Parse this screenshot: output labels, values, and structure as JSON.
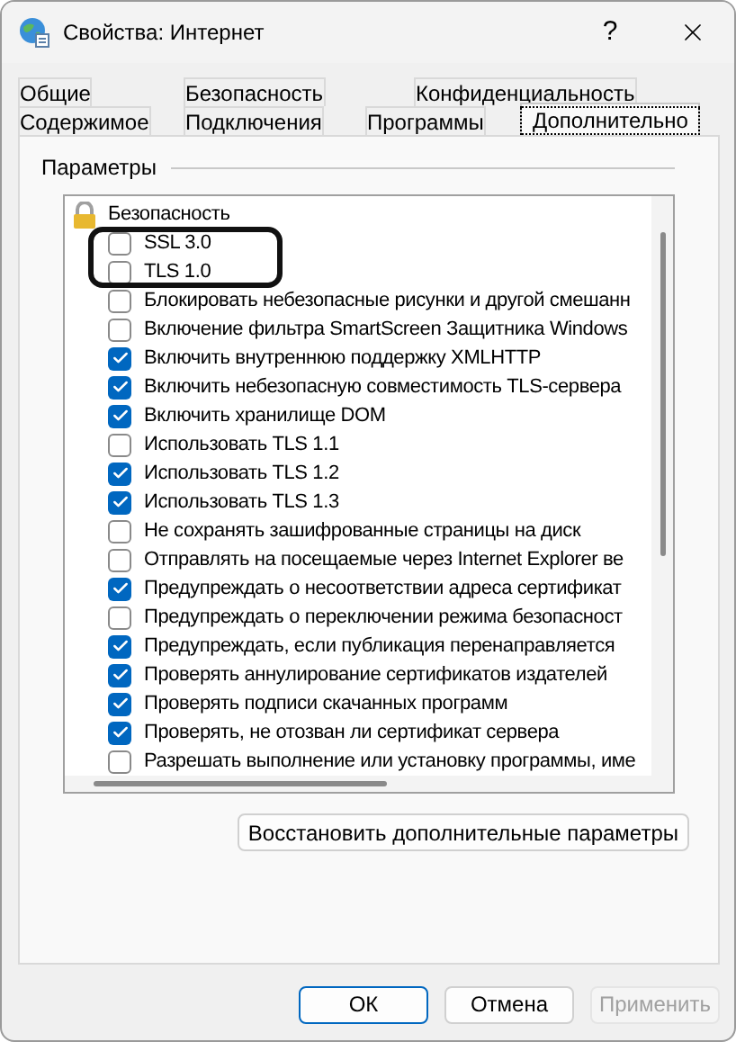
{
  "window": {
    "title": "Свойства: Интернет",
    "help": "?"
  },
  "tabs_back": [
    {
      "label": "Общие",
      "selected": false
    },
    {
      "label": "Безопасность",
      "selected": false
    },
    {
      "label": "Конфиденциальность",
      "selected": false
    }
  ],
  "tabs": [
    {
      "label": "Содержимое",
      "selected": false
    },
    {
      "label": "Подключения",
      "selected": false
    },
    {
      "label": "Программы",
      "selected": false
    },
    {
      "label": "Дополнительно",
      "selected": true
    }
  ],
  "group": {
    "title": "Параметры"
  },
  "settings": [
    {
      "kind": "header",
      "label": "Безопасность"
    },
    {
      "kind": "checkbox",
      "label": "SSL 3.0",
      "checked": false
    },
    {
      "kind": "checkbox",
      "label": "TLS 1.0",
      "checked": false
    },
    {
      "kind": "checkbox",
      "label": "Блокировать небезопасные рисунки и другой смешанн",
      "checked": false
    },
    {
      "kind": "checkbox",
      "label": "Включение фильтра SmartScreen Защитника Windows",
      "checked": false
    },
    {
      "kind": "checkbox",
      "label": "Включить внутреннюю поддержку XMLHTTP",
      "checked": true
    },
    {
      "kind": "checkbox",
      "label": "Включить небезопасную совместимость TLS-сервера",
      "checked": true
    },
    {
      "kind": "checkbox",
      "label": "Включить хранилище DOM",
      "checked": true
    },
    {
      "kind": "checkbox",
      "label": "Использовать TLS 1.1",
      "checked": false
    },
    {
      "kind": "checkbox",
      "label": "Использовать TLS 1.2",
      "checked": true
    },
    {
      "kind": "checkbox",
      "label": "Использовать TLS 1.3",
      "checked": true
    },
    {
      "kind": "checkbox",
      "label": "Не сохранять зашифрованные страницы на диск",
      "checked": false
    },
    {
      "kind": "checkbox",
      "label": "Отправлять на посещаемые через Internet Explorer ве",
      "checked": false
    },
    {
      "kind": "checkbox",
      "label": "Предупреждать о несоответствии адреса сертификат",
      "checked": true
    },
    {
      "kind": "checkbox",
      "label": "Предупреждать о переключении режима безопасност",
      "checked": false
    },
    {
      "kind": "checkbox",
      "label": "Предупреждать, если публикация перенаправляется",
      "checked": true
    },
    {
      "kind": "checkbox",
      "label": "Проверять аннулирование сертификатов издателей",
      "checked": true
    },
    {
      "kind": "checkbox",
      "label": "Проверять подписи скачанных программ",
      "checked": true
    },
    {
      "kind": "checkbox",
      "label": "Проверять, не отозван ли сертификат сервера",
      "checked": true
    },
    {
      "kind": "checkbox",
      "label": "Разрешать выполнение или установку программы, име",
      "checked": false
    }
  ],
  "annotation": {
    "kind": "highlight-frame"
  },
  "restore_button": {
    "label": "Восстановить дополнительные параметры"
  },
  "buttons": [
    {
      "label": "ОК",
      "kind": "default",
      "disabled": false
    },
    {
      "label": "Отмена",
      "kind": "normal",
      "disabled": false
    },
    {
      "label": "Применить",
      "kind": "normal",
      "disabled": true
    }
  ]
}
